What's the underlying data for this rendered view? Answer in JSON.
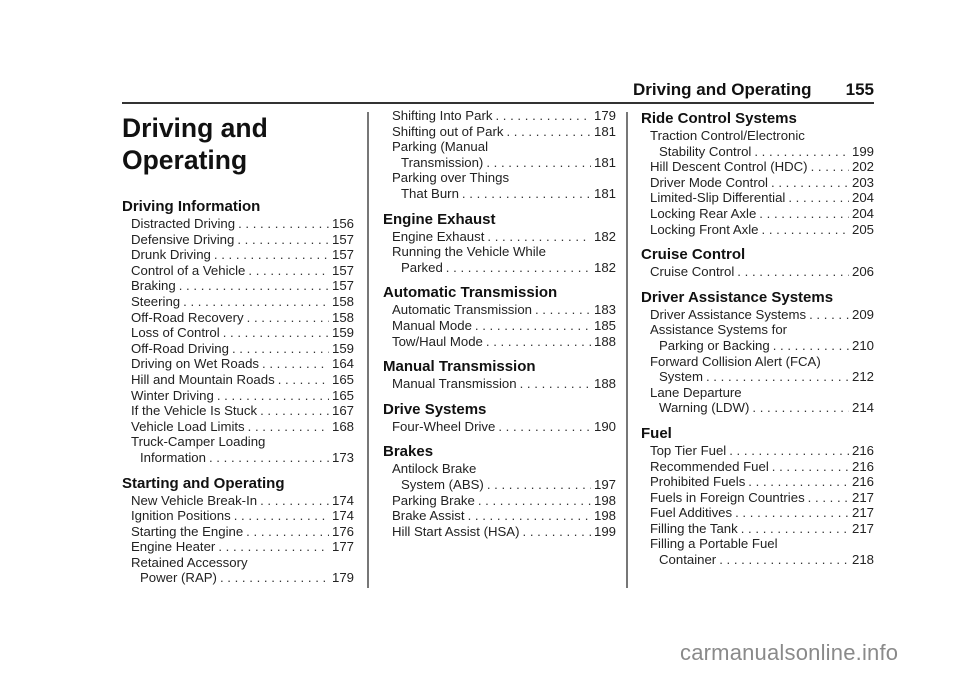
{
  "header": {
    "section_title": "Driving and Operating",
    "page_number": "155"
  },
  "chapter": {
    "title_line1": "Driving and",
    "title_line2": "Operating"
  },
  "columns": [
    {
      "sections": [
        {
          "title": "Driving Information",
          "entries": [
            {
              "label": "Distracted Driving",
              "page": "156"
            },
            {
              "label": "Defensive Driving",
              "page": "157"
            },
            {
              "label": "Drunk Driving",
              "page": "157"
            },
            {
              "label": "Control of a Vehicle",
              "page": "157"
            },
            {
              "label": "Braking",
              "page": "157"
            },
            {
              "label": "Steering",
              "page": "158"
            },
            {
              "label": "Off-Road Recovery",
              "page": "158"
            },
            {
              "label": "Loss of Control",
              "page": "159"
            },
            {
              "label": "Off-Road Driving",
              "page": "159"
            },
            {
              "label": "Driving on Wet Roads",
              "page": "164"
            },
            {
              "label": "Hill and Mountain Roads",
              "page": "165"
            },
            {
              "label": "Winter Driving",
              "page": "165"
            },
            {
              "label": "If the Vehicle Is Stuck",
              "page": "167"
            },
            {
              "label": "Vehicle Load Limits",
              "page": "168"
            },
            {
              "label_line1": "Truck-Camper Loading",
              "label": "Information",
              "page": "173"
            }
          ]
        },
        {
          "title": "Starting and Operating",
          "entries": [
            {
              "label": "New Vehicle Break-In",
              "page": "174"
            },
            {
              "label": "Ignition Positions",
              "page": "174"
            },
            {
              "label": "Starting the Engine",
              "page": "176"
            },
            {
              "label": "Engine Heater",
              "page": "177"
            },
            {
              "label_line1": "Retained Accessory",
              "label": "Power (RAP)",
              "page": "179"
            }
          ]
        }
      ]
    },
    {
      "sections": [
        {
          "title": "",
          "entries": [
            {
              "label": "Shifting Into Park",
              "page": "179"
            },
            {
              "label": "Shifting out of Park",
              "page": "181"
            },
            {
              "label_line1": "Parking (Manual",
              "label": "Transmission)",
              "page": "181"
            },
            {
              "label_line1": "Parking over Things",
              "label": "That Burn",
              "page": "181"
            }
          ]
        },
        {
          "title": "Engine Exhaust",
          "entries": [
            {
              "label": "Engine Exhaust",
              "page": "182"
            },
            {
              "label_line1": "Running the Vehicle While",
              "label": "Parked",
              "page": "182"
            }
          ]
        },
        {
          "title": "Automatic Transmission",
          "entries": [
            {
              "label": "Automatic Transmission",
              "page": "183"
            },
            {
              "label": "Manual Mode",
              "page": "185"
            },
            {
              "label": "Tow/Haul Mode",
              "page": "188"
            }
          ]
        },
        {
          "title": "Manual Transmission",
          "entries": [
            {
              "label": "Manual Transmission",
              "page": "188"
            }
          ]
        },
        {
          "title": "Drive Systems",
          "entries": [
            {
              "label": "Four-Wheel Drive",
              "page": "190"
            }
          ]
        },
        {
          "title": "Brakes",
          "entries": [
            {
              "label_line1": "Antilock Brake",
              "label": "System (ABS)",
              "page": "197"
            },
            {
              "label": "Parking Brake",
              "page": "198"
            },
            {
              "label": "Brake Assist",
              "page": "198"
            },
            {
              "label": "Hill Start Assist (HSA)",
              "page": "199"
            }
          ]
        }
      ]
    },
    {
      "sections": [
        {
          "title": "Ride Control Systems",
          "entries": [
            {
              "label_line1": "Traction Control/Electronic",
              "label": "Stability Control",
              "page": "199"
            },
            {
              "label": "Hill Descent Control (HDC)",
              "page": "202"
            },
            {
              "label": "Driver Mode Control",
              "page": "203"
            },
            {
              "label": "Limited-Slip Differential",
              "page": "204"
            },
            {
              "label": "Locking Rear Axle",
              "page": "204"
            },
            {
              "label": "Locking Front Axle",
              "page": "205"
            }
          ]
        },
        {
          "title": "Cruise Control",
          "entries": [
            {
              "label": "Cruise Control",
              "page": "206"
            }
          ]
        },
        {
          "title": "Driver Assistance Systems",
          "entries": [
            {
              "label": "Driver Assistance Systems",
              "page": "209"
            },
            {
              "label_line1": "Assistance Systems for",
              "label": "Parking or Backing",
              "page": "210"
            },
            {
              "label_line1": "Forward Collision Alert (FCA)",
              "label": "System",
              "page": "212"
            },
            {
              "label_line1": "Lane Departure",
              "label": "Warning (LDW)",
              "page": "214"
            }
          ]
        },
        {
          "title": "Fuel",
          "entries": [
            {
              "label": "Top Tier Fuel",
              "page": "216"
            },
            {
              "label": "Recommended Fuel",
              "page": "216"
            },
            {
              "label": "Prohibited Fuels",
              "page": "216"
            },
            {
              "label": "Fuels in Foreign Countries",
              "page": "217"
            },
            {
              "label": "Fuel Additives",
              "page": "217"
            },
            {
              "label": "Filling the Tank",
              "page": "217"
            },
            {
              "label_line1": "Filling a Portable Fuel",
              "label": "Container",
              "page": "218"
            }
          ]
        }
      ]
    }
  ],
  "watermark": "carmanualsonline.info"
}
